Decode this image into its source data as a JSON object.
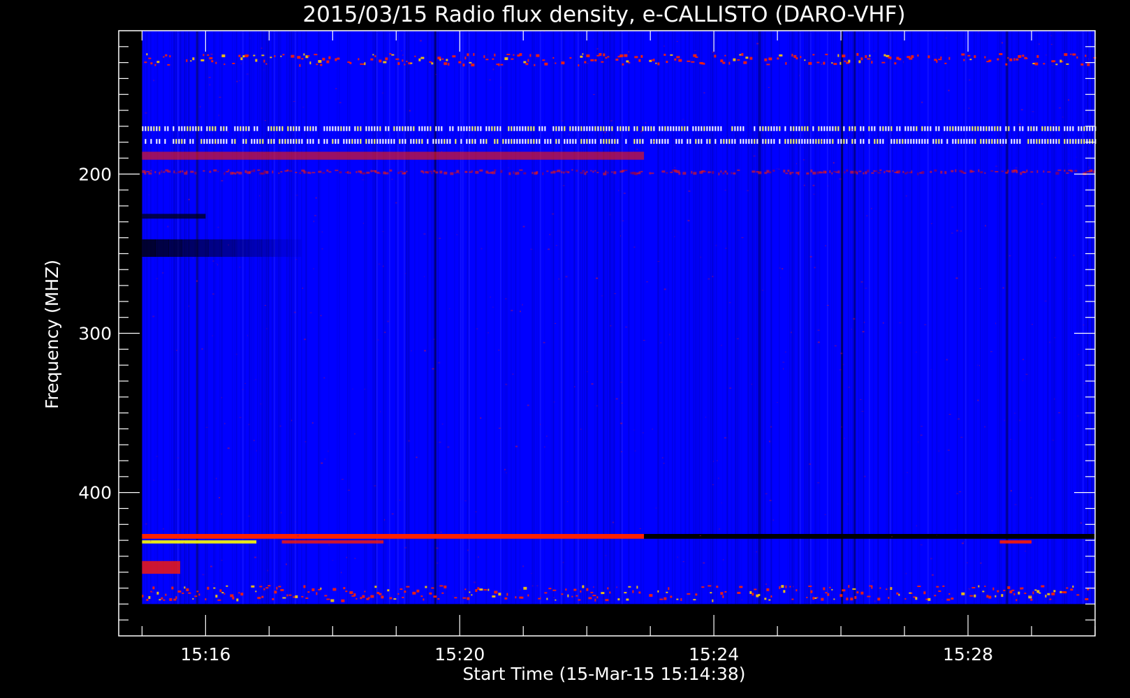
{
  "chart_data": {
    "type": "heatmap",
    "title": "2015/03/15  Radio flux density, e-CALLISTO (DARO-VHF)",
    "xlabel": "Start Time (15-Mar-15 15:14:38)",
    "ylabel": "Frequency (MHZ)",
    "x_ticks": [
      "15:16",
      "15:20",
      "15:24",
      "15:28"
    ],
    "x_tick_minutes": [
      16,
      20,
      24,
      28
    ],
    "x_range_minutes": [
      14.633,
      30.0
    ],
    "data_x_range_minutes": [
      15.0,
      30.0
    ],
    "y_ticks": [
      200,
      300,
      400
    ],
    "y_range": [
      110,
      490
    ],
    "data_y_range": [
      110,
      470
    ],
    "y_inverted": true,
    "colormap": [
      "#000000",
      "#0000ff",
      "#ff0000",
      "#ffff00"
    ],
    "background_level": "blue",
    "bands": [
      {
        "freq_start": 124,
        "freq_end": 132,
        "time_start": 15.0,
        "time_end": 30.0,
        "level": "red-yellow",
        "pattern": "speckled",
        "intensity": 0.9
      },
      {
        "freq_start": 170,
        "freq_end": 173,
        "time_start": 15.0,
        "time_end": 30.0,
        "level": "white",
        "pattern": "dashed",
        "intensity": 1.0
      },
      {
        "freq_start": 178,
        "freq_end": 181,
        "time_start": 15.0,
        "time_end": 30.0,
        "level": "white",
        "pattern": "dashed",
        "intensity": 1.0
      },
      {
        "freq_start": 186,
        "freq_end": 191,
        "time_start": 15.0,
        "time_end": 22.9,
        "level": "red",
        "pattern": "solid",
        "intensity": 0.6
      },
      {
        "freq_start": 197,
        "freq_end": 200,
        "time_start": 15.0,
        "time_end": 30.0,
        "level": "red",
        "pattern": "speckled",
        "intensity": 0.6
      },
      {
        "freq_start": 225,
        "freq_end": 228,
        "time_start": 15.0,
        "time_end": 16.0,
        "level": "black",
        "pattern": "solid",
        "intensity": 0.7
      },
      {
        "freq_start": 241,
        "freq_end": 252,
        "time_start": 15.0,
        "time_end": 17.5,
        "level": "black",
        "pattern": "fade",
        "intensity": 0.8
      },
      {
        "freq_start": 426,
        "freq_end": 429,
        "time_start": 15.0,
        "time_end": 22.9,
        "level": "red-yellow",
        "pattern": "solid",
        "intensity": 1.0
      },
      {
        "freq_start": 426,
        "freq_end": 429,
        "time_start": 22.9,
        "time_end": 30.0,
        "level": "black",
        "pattern": "solid",
        "intensity": 1.0
      },
      {
        "freq_start": 430,
        "freq_end": 432,
        "time_start": 15.0,
        "time_end": 16.8,
        "level": "yellow",
        "pattern": "solid",
        "intensity": 0.9
      },
      {
        "freq_start": 430,
        "freq_end": 432,
        "time_start": 17.2,
        "time_end": 18.8,
        "level": "red",
        "pattern": "solid",
        "intensity": 0.8
      },
      {
        "freq_start": 430,
        "freq_end": 432,
        "time_start": 28.5,
        "time_end": 29.0,
        "level": "red",
        "pattern": "solid",
        "intensity": 0.9
      },
      {
        "freq_start": 443,
        "freq_end": 451,
        "time_start": 15.0,
        "time_end": 15.6,
        "level": "red",
        "pattern": "solid",
        "intensity": 0.8
      },
      {
        "freq_start": 458,
        "freq_end": 468,
        "time_start": 15.0,
        "time_end": 30.0,
        "level": "red-yellow",
        "pattern": "speckled",
        "intensity": 0.9
      }
    ]
  }
}
